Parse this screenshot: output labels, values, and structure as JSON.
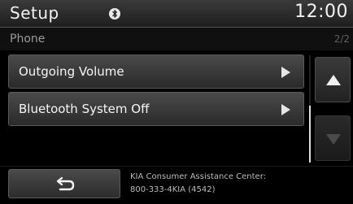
{
  "header": {
    "title": "Setup",
    "clock": "12:00",
    "status_icon": "bluetooth-icon"
  },
  "subheader": {
    "title": "Phone",
    "page": "2/2"
  },
  "menu": {
    "items": [
      {
        "label": "Outgoing Volume",
        "icon": "play-arrow-icon"
      },
      {
        "label": "Bluetooth System Off",
        "icon": "play-arrow-icon"
      }
    ]
  },
  "scroll": {
    "up_icon": "up-triangle-icon",
    "down_icon": "down-triangle-icon"
  },
  "footer": {
    "back_icon": "back-arrow-icon",
    "info_line1": "KIA Consumer Assistance Center:",
    "info_line2": "800-333-4KIA (4542)"
  },
  "colors": {
    "background": "#000000",
    "button_top": "#4a4a4a",
    "button_bottom": "#2a2a2a",
    "text": "#f5f5f5",
    "muted_text": "#9a9a9a"
  }
}
